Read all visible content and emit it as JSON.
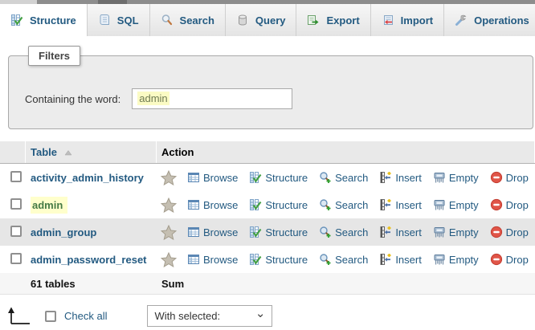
{
  "tabs": [
    {
      "label": "Structure",
      "icon": "structure-icon",
      "active": true
    },
    {
      "label": "SQL",
      "icon": "sql-icon",
      "active": false
    },
    {
      "label": "Search",
      "icon": "search-icon",
      "active": false
    },
    {
      "label": "Query",
      "icon": "query-icon",
      "active": false
    },
    {
      "label": "Export",
      "icon": "export-icon",
      "active": false
    },
    {
      "label": "Import",
      "icon": "import-icon",
      "active": false
    },
    {
      "label": "Operations",
      "icon": "operations-icon",
      "active": false
    }
  ],
  "filters": {
    "legend": "Filters",
    "label": "Containing the word:",
    "value": "admin"
  },
  "table": {
    "col_table": "Table",
    "col_action": "Action",
    "sort_order": "ascending",
    "actions": [
      "Browse",
      "Structure",
      "Search",
      "Insert",
      "Empty",
      "Drop"
    ],
    "rows": [
      {
        "name": "activity_admin_history",
        "highlighted": false
      },
      {
        "name": "admin",
        "highlighted": true
      },
      {
        "name": "admin_group",
        "highlighted": false
      },
      {
        "name": "admin_password_reset",
        "highlighted": false
      }
    ],
    "footer_count": "61 tables",
    "footer_sum": "Sum"
  },
  "bottom": {
    "check_all": "Check all",
    "with_selected": "With selected:"
  },
  "colors": {
    "link_blue": "#235a81",
    "mark_bg": "#ffffcc",
    "mark_text": "#457a45",
    "drop_red": "#e05548",
    "row_shaded": "#e6e6e6",
    "fieldset_bg": "#ececec"
  }
}
